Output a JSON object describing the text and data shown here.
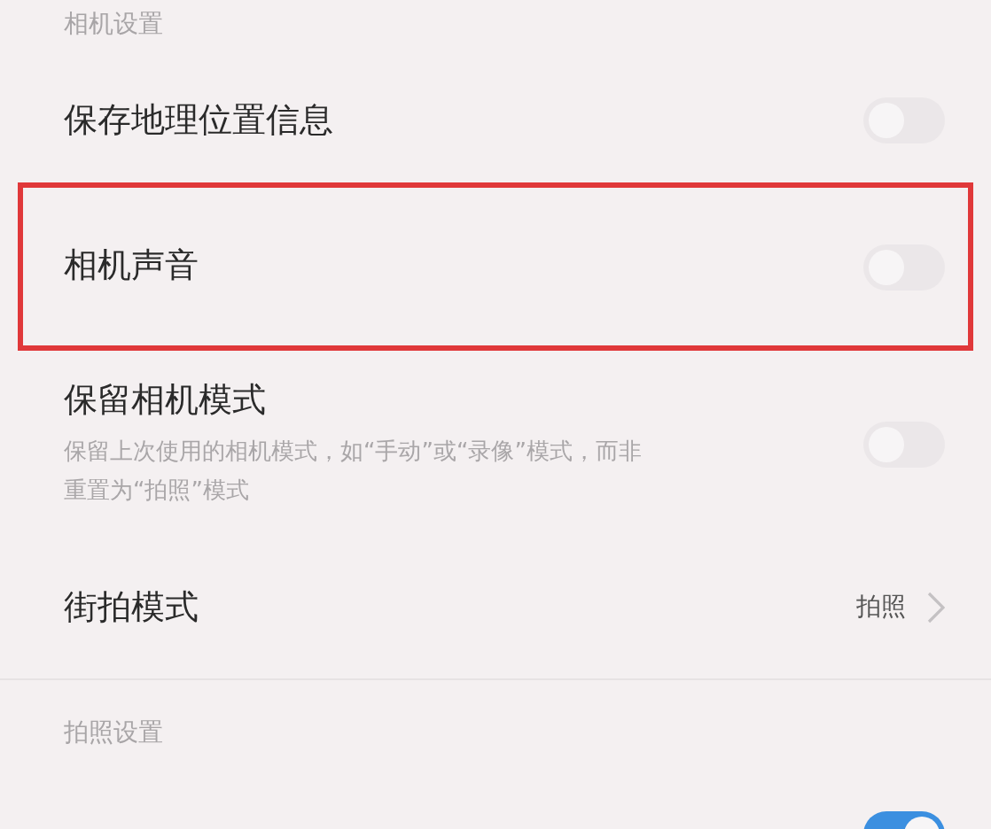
{
  "sections": [
    {
      "header": "相机设置",
      "items": [
        {
          "kind": "toggle",
          "title": "保存地理位置信息",
          "on": false,
          "highlighted": false
        },
        {
          "kind": "toggle",
          "title": "相机声音",
          "on": false,
          "highlighted": true
        },
        {
          "kind": "toggle",
          "title": "保留相机模式",
          "description": "保留上次使用的相机模式，如“手动”或“录像”模式，而非重置为“拍照”模式",
          "on": false,
          "highlighted": false
        },
        {
          "kind": "link",
          "title": "街拍模式",
          "value": "拍照",
          "highlighted": false
        }
      ]
    },
    {
      "header": "拍照设置",
      "items": [
        {
          "kind": "toggle",
          "on": true,
          "highlighted": false
        }
      ]
    }
  ]
}
